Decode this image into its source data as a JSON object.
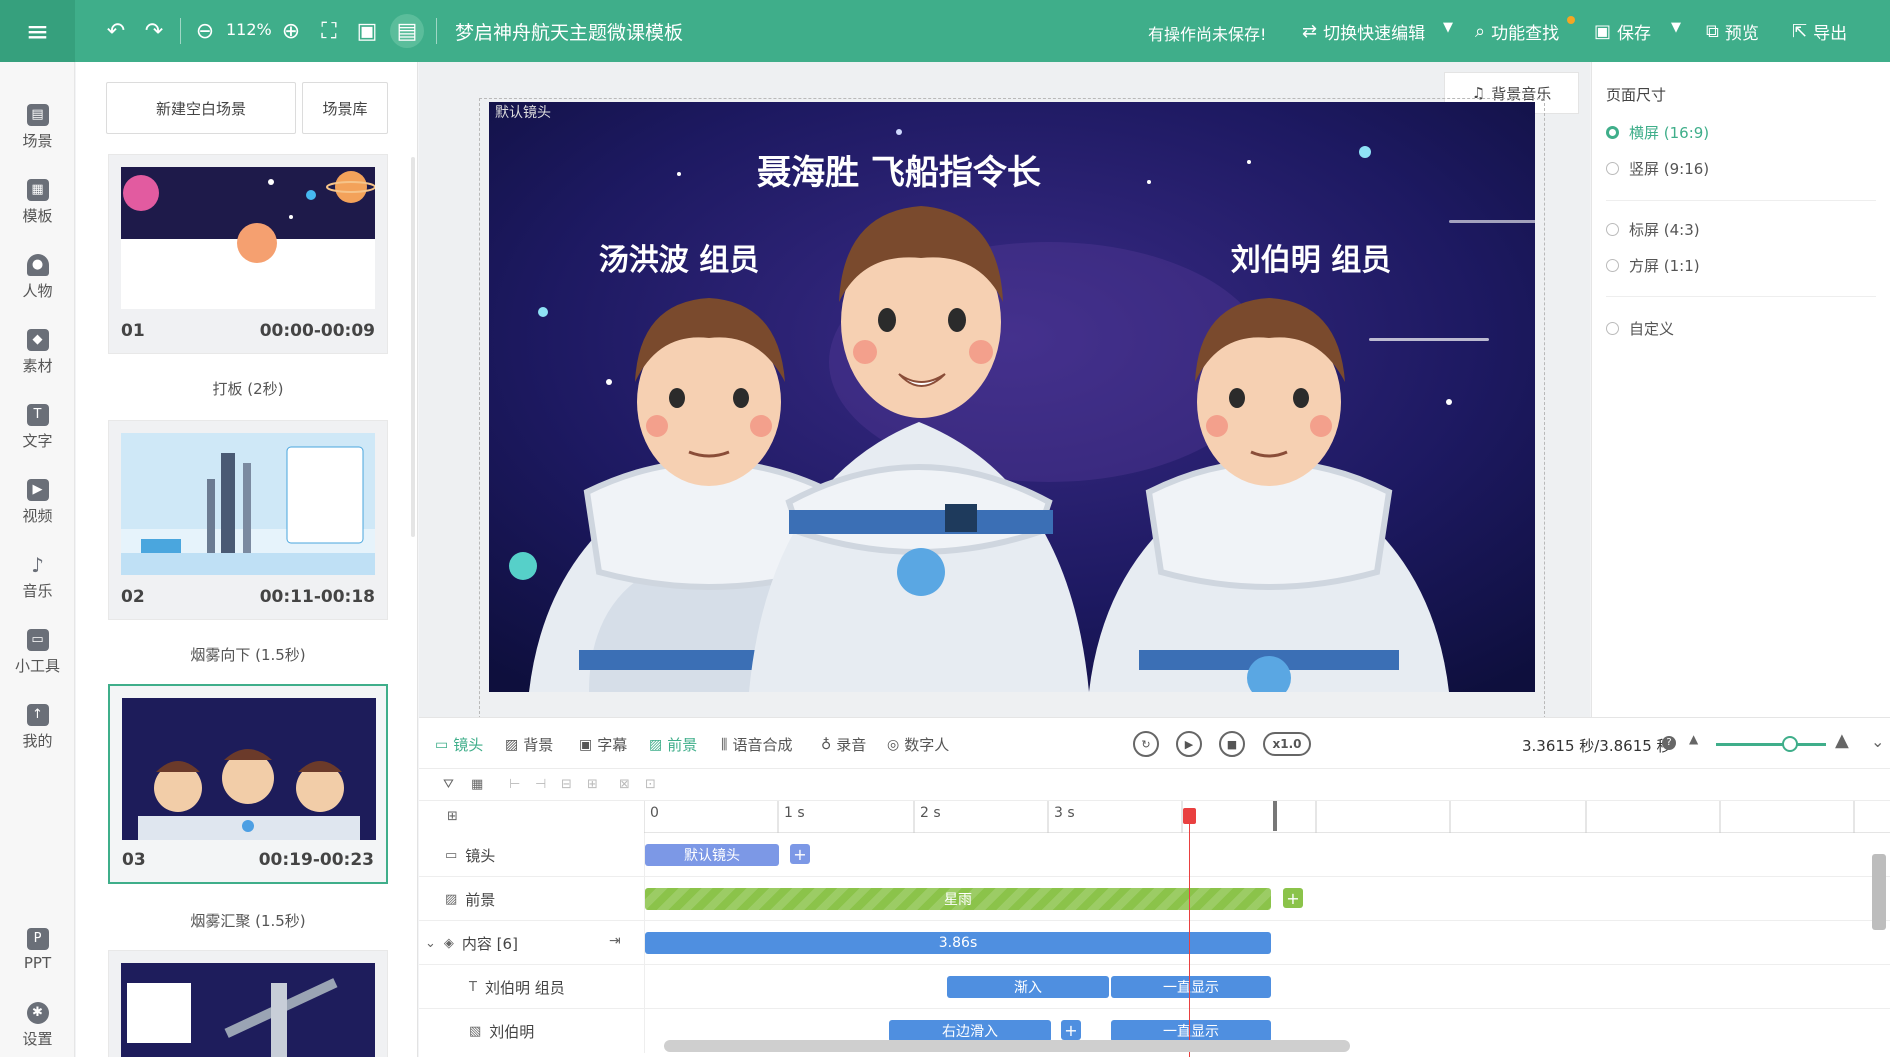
{
  "header": {
    "zoom": "112%",
    "title": "梦启神舟航天主题微课模板",
    "unsaved_notice": "有操作尚未保存!",
    "switch_edit": "切换快速编辑",
    "feature_search": "功能查找",
    "save": "保存",
    "preview": "预览",
    "export": "导出"
  },
  "nav": [
    {
      "label": "场景",
      "icon": "scene-icon"
    },
    {
      "label": "模板",
      "icon": "template-icon"
    },
    {
      "label": "人物",
      "icon": "person-icon"
    },
    {
      "label": "素材",
      "icon": "material-icon"
    },
    {
      "label": "文字",
      "icon": "text-icon"
    },
    {
      "label": "视频",
      "icon": "video-icon"
    },
    {
      "label": "音乐",
      "icon": "music-icon"
    },
    {
      "label": "小工具",
      "icon": "toolbox-icon"
    },
    {
      "label": "我的",
      "icon": "upload-icon"
    },
    {
      "label": "PPT",
      "icon": "ppt-icon"
    },
    {
      "label": "设置",
      "icon": "settings-icon"
    }
  ],
  "scene_panel": {
    "new_blank": "新建空白场景",
    "library": "场景库",
    "scenes": [
      {
        "num": "01",
        "time": "00:00-00:09",
        "transition": "打板 (2秒)"
      },
      {
        "num": "02",
        "time": "00:11-00:18",
        "transition": "烟雾向下 (1.5秒)"
      },
      {
        "num": "03",
        "time": "00:19-00:23",
        "transition": "烟雾汇聚 (1.5秒)"
      }
    ]
  },
  "stage": {
    "bg_music": "背景音乐",
    "lens_label": "默认镜头",
    "canvas_title": "聂海胜 飞船指令长",
    "left_caption": "汤洪波 组员",
    "right_caption": "刘伯明 组员"
  },
  "right_panel": {
    "title": "页面尺寸",
    "options": [
      "横屏 (16:9)",
      "竖屏 (9:16)",
      "标屏 (4:3)",
      "方屏 (1:1)",
      "自定义"
    ],
    "selected": "横屏 (16:9)"
  },
  "timeline_toolbar": {
    "tabs": [
      "镜头",
      "背景",
      "字幕",
      "前景",
      "语音合成",
      "录音",
      "数字人"
    ],
    "speed": "x1.0",
    "time": "3.3615 秒/3.8615 秒"
  },
  "timeline": {
    "ruler": [
      "0",
      "1 s",
      "2 s",
      "3 s"
    ],
    "rows": [
      {
        "label": "镜头",
        "clip": "默认镜头"
      },
      {
        "label": "前景",
        "clip": "星雨"
      },
      {
        "label": "内容 [6]",
        "clip": "3.86s"
      },
      {
        "label": "刘伯明 组员",
        "clip_a": "渐入",
        "clip_b": "一直显示"
      },
      {
        "label": "刘伯明",
        "clip_a": "右边滑入",
        "clip_b": "一直显示"
      }
    ]
  },
  "colors": {
    "accent": "#3fae8a",
    "clip_blue": "#4f8fe0",
    "clip_green": "#8bc34a",
    "playhead": "#e94040"
  }
}
